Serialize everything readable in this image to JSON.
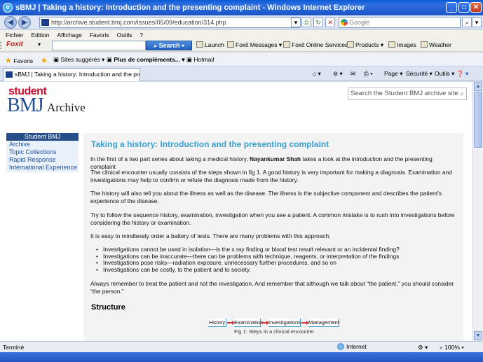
{
  "window": {
    "title": "sBMJ | Taking a history: Introduction and the presenting complaint - Windows Internet Explorer"
  },
  "address": {
    "url": "http://archive.student.bmj.com/issues/05/09/education/314.php",
    "search_placeholder": "Google"
  },
  "menu": [
    "Fichier",
    "Edition",
    "Affichage",
    "Favoris",
    "Outils",
    "?"
  ],
  "foxit": {
    "logo": "Foxit",
    "search_label": "Search",
    "items": [
      "Launch",
      "Foxit Messages",
      "Foxit Online Services",
      "Products",
      "Images",
      "Weather"
    ]
  },
  "favorites": {
    "label": "Favoris",
    "items": [
      "Sites suggérés",
      "Plus de compléments...",
      "Hotmail"
    ]
  },
  "tab": {
    "label": "sBMJ | Taking a history: Introduction and the presenti..."
  },
  "commands": [
    "Page",
    "Sécurité",
    "Outils"
  ],
  "site": {
    "logo_student": "student",
    "logo_bmj": "BMJ",
    "logo_archive": "Archive",
    "search_placeholder": "Search the Student BMJ archive site",
    "sidebar": {
      "heading": "Student BMJ",
      "links": [
        "Archive",
        "Topic Collections",
        "Rapid Response",
        "International Experience"
      ]
    }
  },
  "article": {
    "title": "Taking a history: Introduction and the presenting complaint",
    "intro_before": "In the first of a two part series about taking a medical history, ",
    "author": "Nayankumar Shah",
    "intro_after": " takes a look at the introduction and the presenting complaint",
    "p1": "The clinical encounter usually consists of the steps shown in fig 1. A good history is very important for making a diagnosis. Examination and investigations may help to confirm or refute the diagnosis made from the history.",
    "p2": "The history will also tell you about the illness as well as the disease. The illness is the subjective component and describes the patient’s experience of the disease.",
    "p3": "Try to follow the sequence history, examination, investigation when you see a patient. A common mistake is to rush into investigations before considering the history or examination.",
    "p4": "It is easy to mindlessly order a battery of tests. There are many problems with this approach:",
    "bullets": [
      "Investigations cannot be used in isolation—is the x ray finding or blood test result relevant or an incidental finding?",
      "Investigations can be inaccurate—there can be problems with technique, reagents, or interpretation of the findings",
      "Investigations pose risks—radiation exposure, unnecessary further procedures, and so on",
      "Investigations can be costly, to the patient and to society."
    ],
    "p5": "Always remember to treat the patient and not the investigation. And remember that although we talk about “the patient,” you should consider “the person.”",
    "section_heading": "Structure",
    "flow": [
      "History",
      "Examination",
      "Investigations",
      "Management"
    ],
    "figure_caption": "Fig 1: Steps in a clinical encounter"
  },
  "status": {
    "text": "Terminé",
    "zone": "Internet",
    "zoom": "100%"
  },
  "colors": {
    "title_bar": "#0a5bd6",
    "article_title": "#3aa0d3",
    "sidebar_header": "#264f8a",
    "link": "#1e4f9c",
    "student_red": "#c8102e"
  }
}
